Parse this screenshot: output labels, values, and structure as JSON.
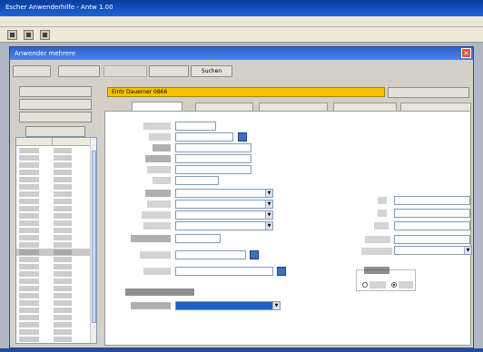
{
  "app": {
    "title": "Escher Anwenderhilfe - Antw 1.00"
  },
  "menu": {
    "items": [
      "",
      "",
      "",
      "",
      "",
      "",
      "",
      ""
    ]
  },
  "toolbar": {
    "icons": [
      "save-icon",
      "print-icon",
      "close-icon"
    ]
  },
  "window": {
    "title": "Anwender mehrere"
  },
  "buttons": {
    "b1": "",
    "b2": "",
    "b3": "",
    "b4": "",
    "search": "Suchen"
  },
  "nav": [
    "",
    "",
    "",
    ""
  ],
  "list": {
    "columns": [
      "",
      ""
    ],
    "rows": [
      [
        "",
        ""
      ],
      [
        "",
        ""
      ],
      [
        "",
        ""
      ],
      [
        "",
        ""
      ],
      [
        "",
        ""
      ],
      [
        "",
        ""
      ],
      [
        "",
        ""
      ],
      [
        "",
        ""
      ],
      [
        "",
        ""
      ],
      [
        "",
        ""
      ],
      [
        "",
        ""
      ],
      [
        "",
        ""
      ],
      [
        "",
        ""
      ],
      [
        "",
        ""
      ],
      [
        "",
        ""
      ],
      [
        "",
        ""
      ],
      [
        "",
        ""
      ],
      [
        "",
        ""
      ],
      [
        "",
        ""
      ],
      [
        "",
        ""
      ],
      [
        "",
        ""
      ],
      [
        "",
        ""
      ],
      [
        "",
        ""
      ],
      [
        "",
        ""
      ],
      [
        "",
        ""
      ],
      [
        "",
        ""
      ],
      [
        "",
        ""
      ],
      [
        "",
        ""
      ]
    ],
    "selected_index": 14
  },
  "record": {
    "label": "Eintr Dauerner 0866",
    "button": ""
  },
  "tabs": [
    "",
    "",
    "",
    "",
    ""
  ],
  "active_tab": 0,
  "form": {
    "field1": "",
    "field2": "",
    "field3": "",
    "field4": "",
    "field5": "",
    "field6": "",
    "sel1": "",
    "sel2": "",
    "sel3": "",
    "sel4": "",
    "date1": "",
    "field7": "",
    "field8": "",
    "section_title": "",
    "section_select": ""
  },
  "right": {
    "fields": [
      "",
      "",
      "",
      "",
      ""
    ],
    "select": "",
    "group_title": "",
    "radio": [
      "",
      ""
    ],
    "radio_selected": 1
  },
  "colors": {
    "record_bar": "#f5c400",
    "selection": "#1f5fc6"
  }
}
